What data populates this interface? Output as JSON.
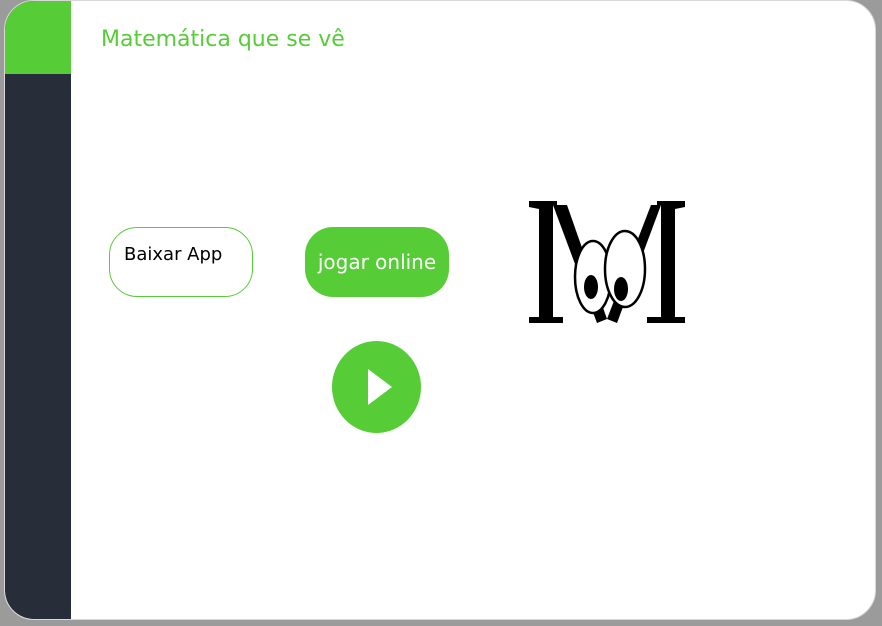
{
  "header": {
    "title": "Matemática que se vê"
  },
  "actions": {
    "download_label": "Baixar App",
    "play_online_label": "jogar online"
  },
  "icons": {
    "play": "play-icon",
    "logo": "m-eyes-logo"
  },
  "colors": {
    "accent": "#56cc37",
    "sidebar": "#272d39"
  }
}
